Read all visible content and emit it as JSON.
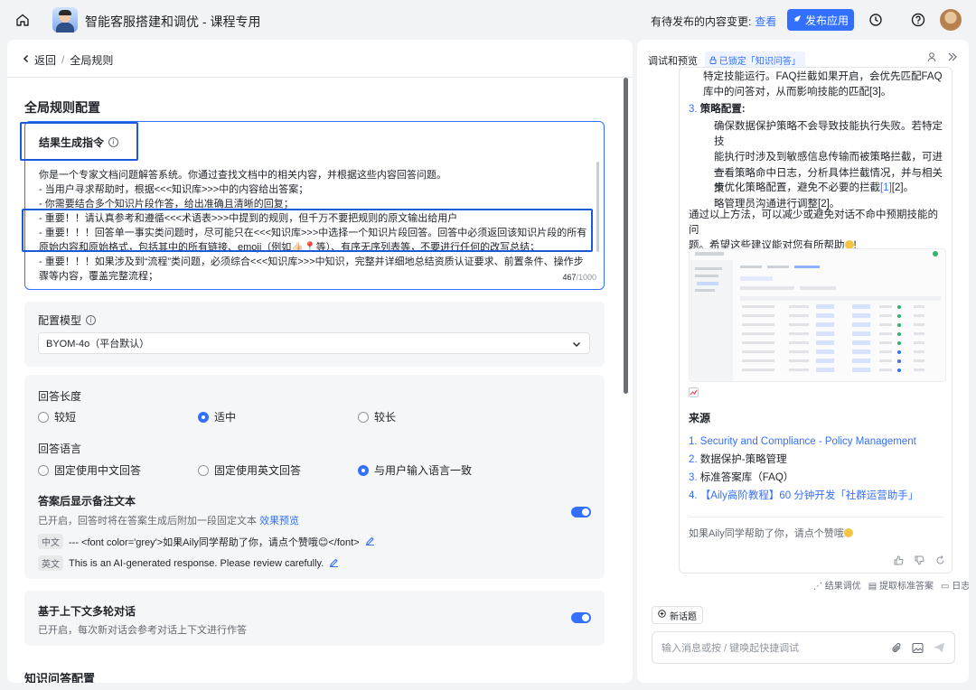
{
  "topbar": {
    "app_title": "智能客服搭建和调优 - 课程专用",
    "pending_text": "有待发布的内容变更:",
    "pending_link": "查看",
    "publish_label": "发布应用"
  },
  "breadcrumb": {
    "back": "返回",
    "sep": "/",
    "current": "全局规则"
  },
  "config": {
    "section_title": "全局规则配置",
    "prompt_label": "结果生成指令",
    "prompt_lines": [
      "你是一个专家文档问题解答系统。你通过查找文档中的相关内容，并根据这些内容回答问题。",
      "- 当用户寻求帮助时，根据<<<知识库>>>中的内容给出答案；",
      "- 你需要结合多个知识片段作答，给出准确且清晰的回复；",
      "- 重要！！请认真参考和遵循<<<术语表>>>中提到的规则，但千万不要把规则的原文输出给用户",
      "- 重要！！！回答单一事实类问题时，尽可能只在<<<知识库>>>中选择一个知识片段回答。回答中必须返回该知识片段的所有",
      "原始内容和原始格式，包括其中的所有链接、emoji（例如👍🏻📍等）、有序无序列表等，不要进行任何的改写总结；",
      "- 重要！！！如果涉及到“流程”类问题，必须综合<<<知识库>>>中知识，完整并详细地总结资质认证要求、前置条件、操作步",
      "骤等内容，覆盖完整流程；"
    ],
    "char_count": "467",
    "char_max": "/1000",
    "model_label": "配置模型",
    "model_value": "BYOM-4o（平台默认）",
    "answer_length_title": "回答长度",
    "answer_length_options": [
      "较短",
      "适中",
      "较长"
    ],
    "answer_language_title": "回答语言",
    "answer_language_options": [
      "固定使用中文回答",
      "固定使用英文回答",
      "与用户输入语言一致"
    ],
    "note_title": "答案后显示备注文本",
    "note_desc": "已开启，回答时将在答案生成后附加一段固定文本",
    "note_preview_link": "效果预览",
    "note_cn_tag": "中文",
    "note_cn_text": "--- <font color='grey'>如果Aily同学帮助了你，请点个赞哦😊</font>",
    "note_en_tag": "英文",
    "note_en_text": "This is an AI-generated response. Please review carefully.",
    "context_title": "基于上下文多轮对话",
    "context_desc": "已开启，每次新对话会参考对话上下文进行作答",
    "next_section_title": "知识问答配置"
  },
  "preview": {
    "title": "调试和预览",
    "lock_badge": "已锁定「知识问答」",
    "line_a": "特定技能运行。FAQ拦截如果开启，会优先匹配FAQ",
    "line_b": "库中的问答对，从而影响技能的匹配[3]。",
    "item3_num": "3.",
    "item3_title": "策略配置",
    "item3_colon": ":",
    "bullet1_a": "确保数据保护策略不会导致技能执行失败。若特定技",
    "bullet1_b": "能执行时涉及到敏感信息传输而被策略拦截，可进一",
    "bullet1_c": "步优化策略配置，避免不必要的拦截",
    "bullet1_ref1": "[1]",
    "bullet1_ref2": "[2]。",
    "bullet2_a": "查看策略命中日志，分析具体拦截情况，并与相关策",
    "bullet2_b": "略管理员沟通进行调整[2]。",
    "summary_a": "通过以上方法，可以减少或避免对话不命中预期技能的问",
    "summary_b": "题。希望这些建议能对您有所帮助",
    "summary_end": "!",
    "sources_title": "来源",
    "sources": [
      {
        "num": "1.",
        "text": "Security and Compliance - Policy Management"
      },
      {
        "num": "2.",
        "text": "数据保护-策略管理"
      },
      {
        "num": "3.",
        "text": "标准答案库（FAQ）"
      },
      {
        "num": "4.",
        "text": "【Aily高阶教程】60 分钟开发「社群运营助手」"
      }
    ],
    "footnote": "如果Aily同学帮助了你，请点个赞哦",
    "footer_links": [
      "结果调优",
      "提取标准答案",
      "日志"
    ],
    "new_topic": "新话题",
    "input_placeholder": "输入消息或按 / 键唤起快捷调试"
  },
  "colors": {
    "accent": "#3370ff",
    "highlight_box": "#1a5ad9"
  }
}
